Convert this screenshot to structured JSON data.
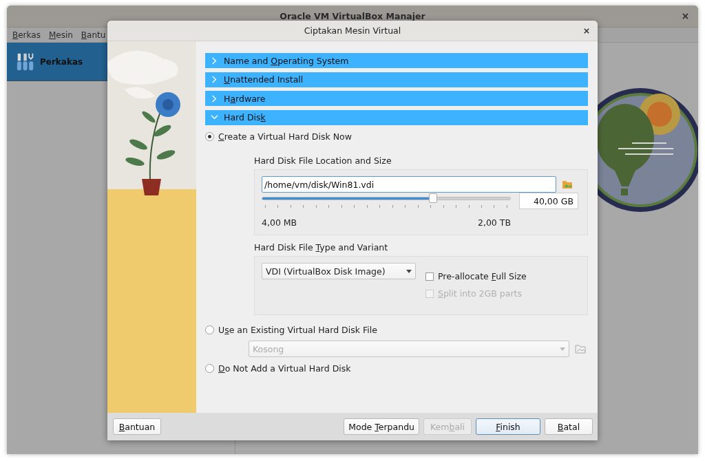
{
  "main_window": {
    "title": "Oracle VM VirtualBox Manajer",
    "menu": [
      {
        "label": "Berkas"
      },
      {
        "label": "Mesin"
      },
      {
        "label": "Bantu"
      }
    ],
    "tools_item": {
      "label": "Perkakas",
      "selected": true
    }
  },
  "dialog": {
    "title": "Ciptakan Mesin Virtual",
    "sections": [
      {
        "label": "Name and Operating System",
        "expanded": false
      },
      {
        "label": "Unattended Install",
        "expanded": false
      },
      {
        "label": "Hardware",
        "expanded": false
      },
      {
        "label": "Hard Disk",
        "expanded": true
      }
    ],
    "create_new": {
      "label": "Create a Virtual Hard Disk Now",
      "selected": true
    },
    "location": {
      "heading": "Hard Disk File Location and Size",
      "path": "/home/vm/disk/Win81.vdi",
      "level": 0.69,
      "size": "40,00 GB",
      "min": "4,00 MB",
      "max": "2,00 TB"
    },
    "variant": {
      "heading": "Hard Disk File Type and Variant",
      "format": "VDI (VirtualBox Disk Image)",
      "checks": [
        {
          "label": "Pre-allocate Full Size",
          "checked": false,
          "disabled": false
        },
        {
          "label": "Split into 2GB parts",
          "checked": false,
          "disabled": true
        }
      ]
    },
    "use_existing": {
      "label": "Use an Existing Virtual Hard Disk File",
      "selected": false,
      "combo": "Kosong",
      "disabled": true
    },
    "no_disk": {
      "label": "Do Not Add a Virtual Hard Disk",
      "selected": false
    },
    "help_button": {
      "label": "Bantuan",
      "disabled": false
    },
    "buttons": [
      {
        "label": "Mode Terpandu",
        "disabled": false,
        "default": false
      },
      {
        "label": "Kembali",
        "disabled": true,
        "default": false
      },
      {
        "label": "Finish",
        "disabled": false,
        "default": true
      },
      {
        "label": "Batal",
        "disabled": false,
        "default": false
      }
    ]
  }
}
